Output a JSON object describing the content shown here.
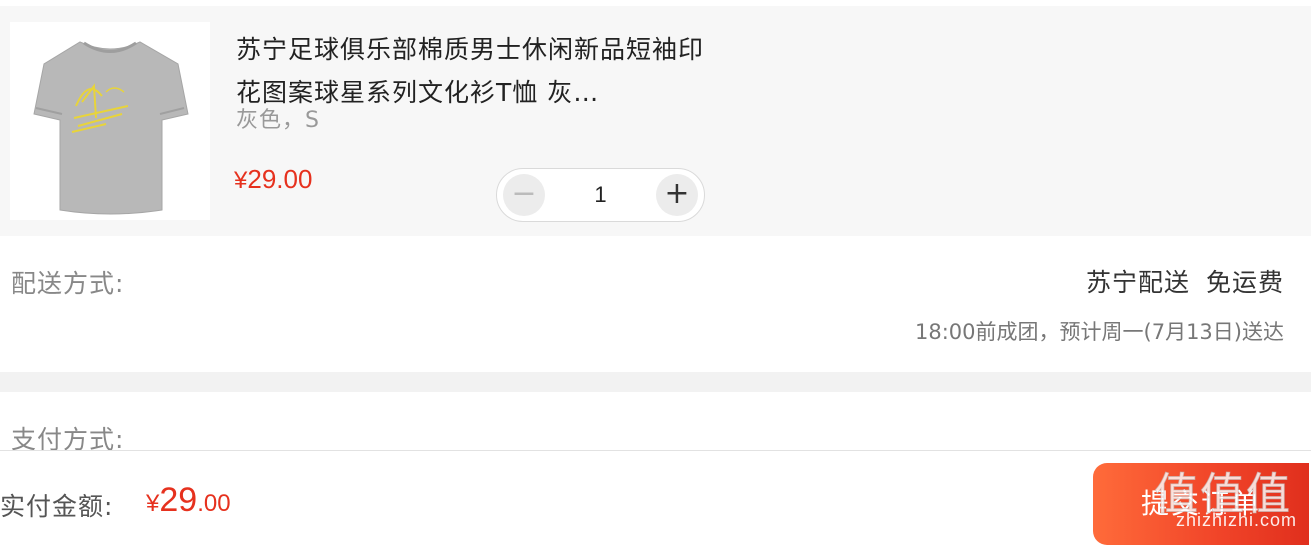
{
  "product": {
    "title": "苏宁足球俱乐部棉质男士休闲新品短袖印花图案球星系列文化衫T恤 灰…",
    "spec": "灰色，S",
    "price_symbol": "¥",
    "price_value": "29.00",
    "quantity": "1",
    "minus_glyph": "−",
    "plus_glyph": "+",
    "image_icon": "tshirt-image",
    "colors": {
      "shirt": "#b9b9b9",
      "print": "#e8d43a"
    }
  },
  "delivery": {
    "label": "配送方式:",
    "method": "苏宁配送",
    "fee": "免运费",
    "note": "18:00前成团，预计周一(7月13日)送达"
  },
  "payment": {
    "label": "支付方式:"
  },
  "bottom": {
    "total_label": "实付金额:",
    "total_symbol": "¥",
    "total_int": "29",
    "total_dec": ".00",
    "submit_label": "提交订单"
  },
  "watermark": {
    "glyphs": "值值值",
    "url": "zhizhizhi.com"
  },
  "colors": {
    "accent": "#e6311e",
    "submit_gradient_start": "#ff6b3a",
    "submit_gradient_end": "#e02f1d",
    "section_bg": "#f7f7f7"
  }
}
